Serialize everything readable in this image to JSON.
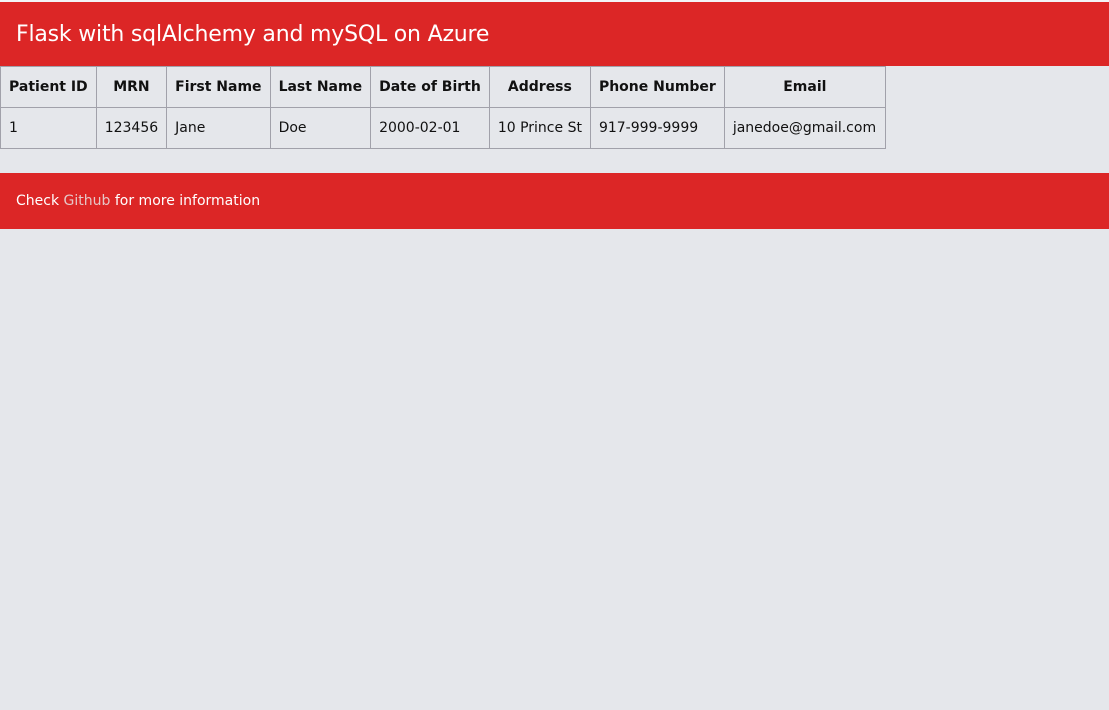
{
  "header": {
    "title": "Flask with sqlAlchemy and mySQL on Azure"
  },
  "table": {
    "columns": [
      "Patient ID",
      "MRN",
      "First Name",
      "Last Name",
      "Date of Birth",
      "Address",
      "Phone Number",
      "Email"
    ],
    "rows": [
      [
        "1",
        "123456",
        "Jane",
        "Doe",
        "2000-02-01",
        "10 Prince St",
        "917-999-9999",
        "janedoe@gmail.com"
      ]
    ]
  },
  "footer": {
    "prefix": "Check",
    "link_text": "Github",
    "suffix": "for more information"
  },
  "colors": {
    "accent": "#dc2626",
    "background": "#e5e7eb",
    "link": "#e5c7c7"
  }
}
